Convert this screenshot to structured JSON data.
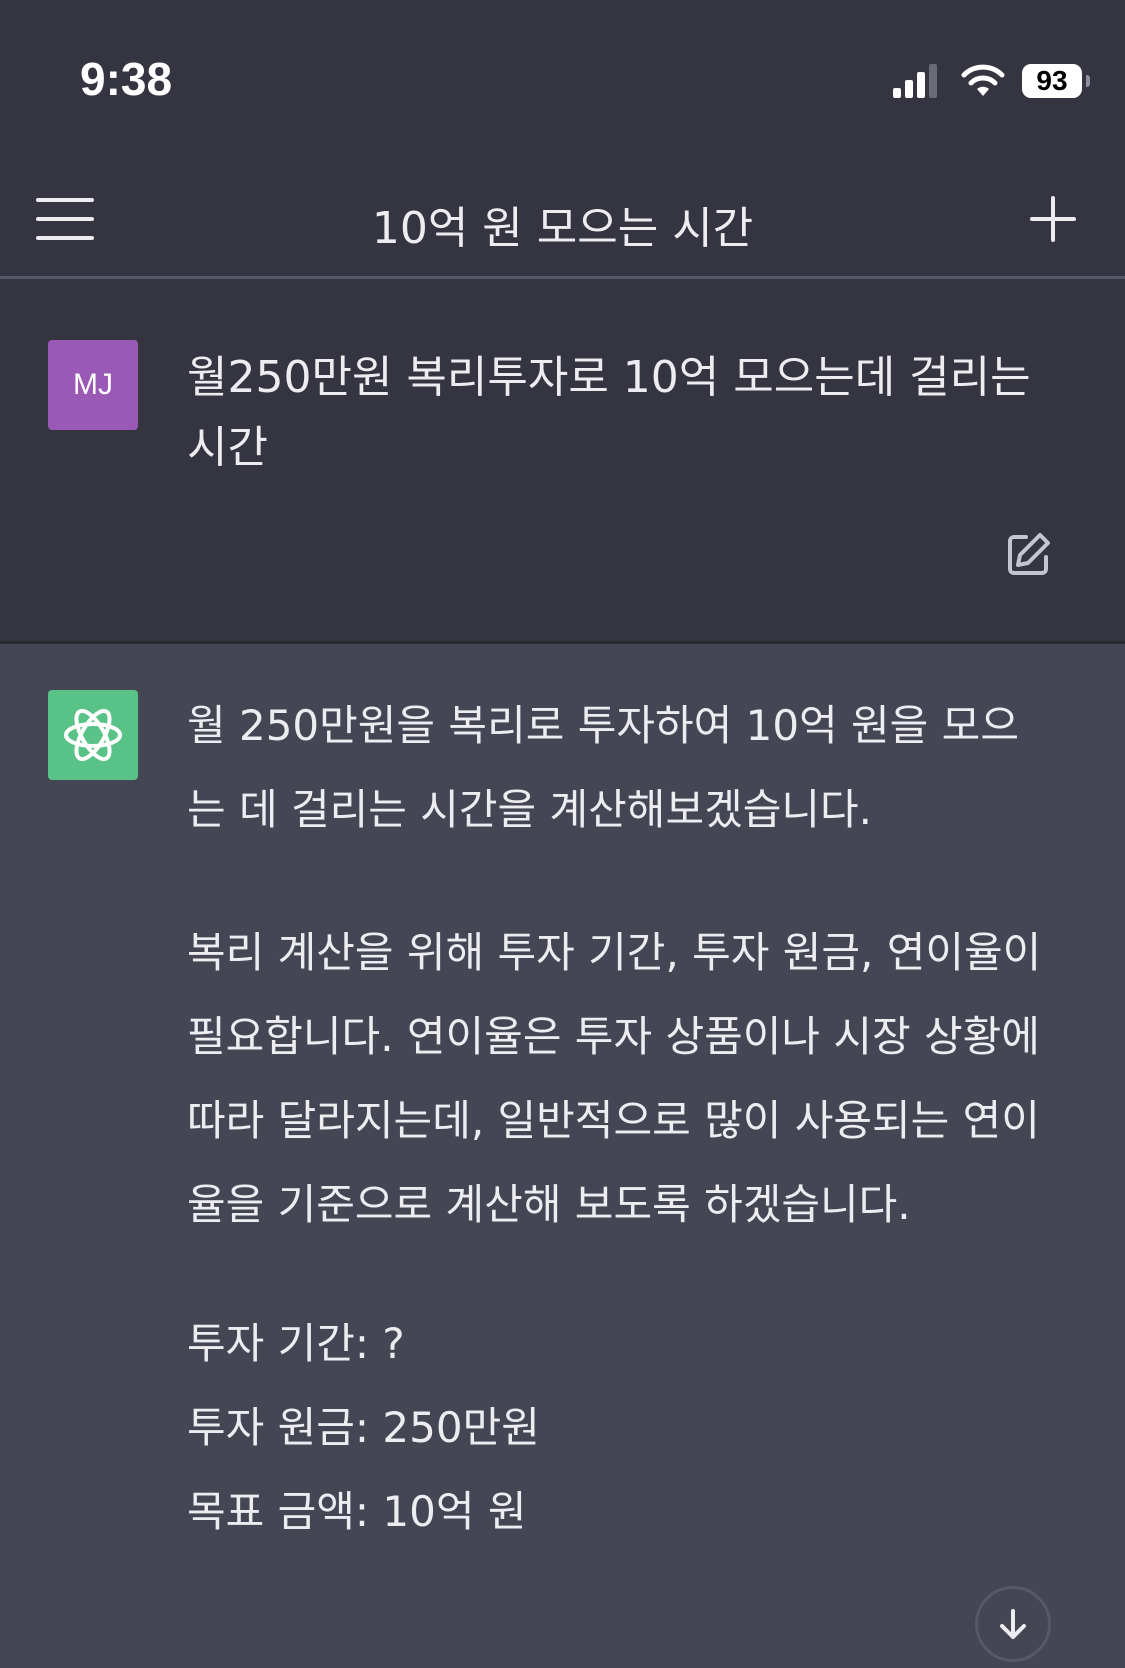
{
  "status_bar": {
    "time": "9:38",
    "battery": "93"
  },
  "nav": {
    "title": "10억 원 모으는 시간",
    "menu_icon": "hamburger-menu-icon",
    "new_icon": "plus-icon"
  },
  "user_message": {
    "avatar": "MJ",
    "text": "월250만원 복리투자로 10억 모으는데 걸리는 시간",
    "edit_icon": "edit-icon"
  },
  "assistant_message": {
    "avatar_icon": "openai-logo-icon",
    "paragraphs": [
      "월 250만원을 복리로 투자하여 10억 원을 모으는 데 걸리는 시간을 계산해보겠습니다.",
      "복리 계산을 위해 투자 기간, 투자 원금, 연이율이 필요합니다. 연이율은 투자 상품이나 시장 상황에 따라 달라지는데, 일반적으로 많이 사용되는 연이율을 기준으로 계산해 보도록 하겠습니다."
    ],
    "list": [
      "투자 기간: ?",
      "투자 원금: 250만원",
      "목표 금액: 10억 원"
    ]
  },
  "scroll_button_icon": "arrow-down-icon",
  "colors": {
    "header_bg": "#343541",
    "assistant_bg": "#444654",
    "user_avatar": "#9b59b6",
    "bot_avatar": "#59c287"
  }
}
